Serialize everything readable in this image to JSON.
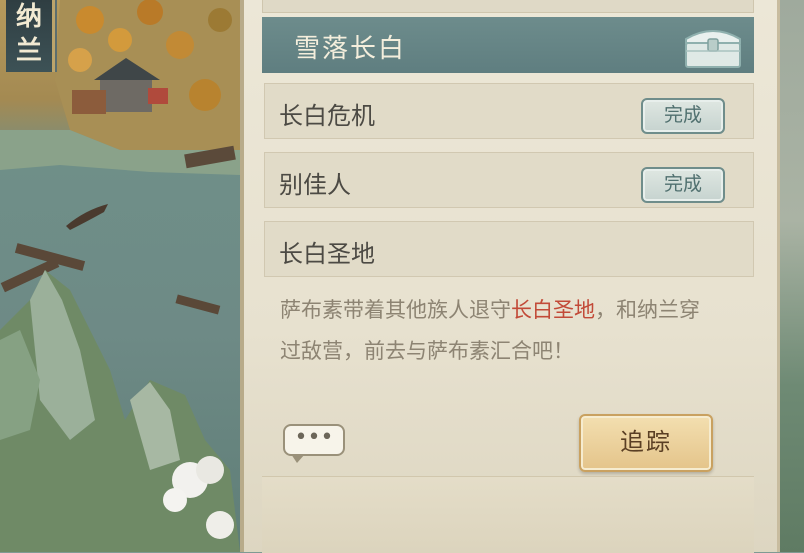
{
  "character": {
    "name_chars": [
      "纳",
      "兰"
    ]
  },
  "chapter": {
    "title": "雪落长白",
    "chest_icon": "treasure-chest-icon"
  },
  "quests": [
    {
      "title": "长白危机",
      "status": "完成"
    },
    {
      "title": "别佳人",
      "status": "完成"
    },
    {
      "title": "长白圣地",
      "status": ""
    }
  ],
  "description": {
    "before": "萨布素带着其他族人退守",
    "highlight": "长白圣地",
    "after": "，和纳兰穿过敌营，前去与萨布素汇合吧！",
    "highlight_color": "#c24a38"
  },
  "chat_button": {
    "label": "•••"
  },
  "track_button": {
    "label": "追踪"
  },
  "colors": {
    "panel_bg": "#e7e1cf",
    "chapter_header": "#658485",
    "accent_gold": "#e4c48a"
  }
}
